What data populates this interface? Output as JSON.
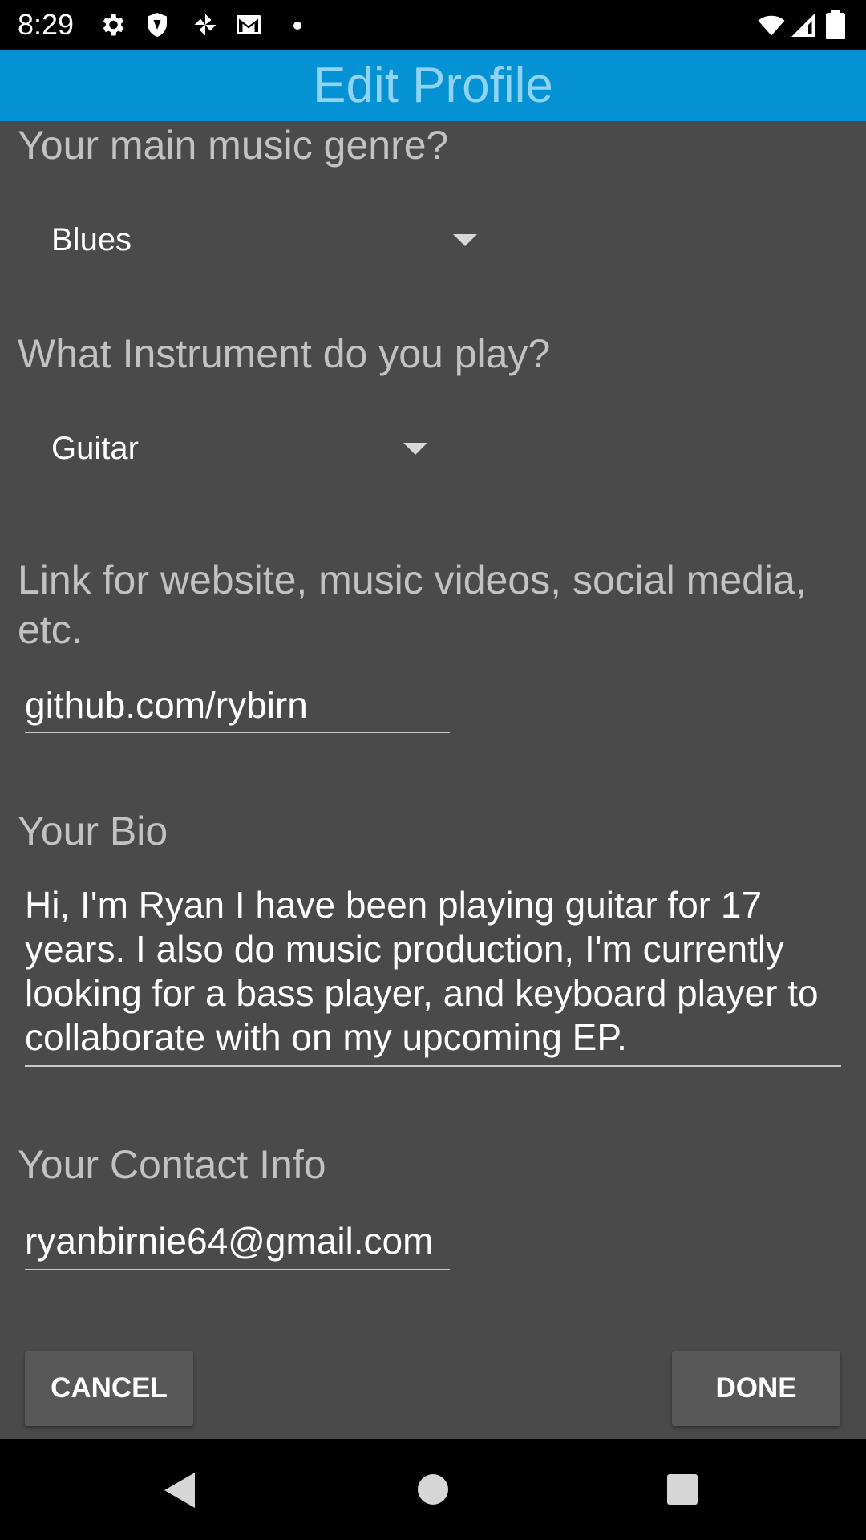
{
  "status_bar": {
    "time": "8:29",
    "icons": [
      "gear-icon",
      "shield-icon",
      "pinwheel-icon",
      "gmail-icon",
      "notification-dot",
      "wifi-icon",
      "signal-icon",
      "battery-icon"
    ]
  },
  "app_bar": {
    "title": "Edit Profile",
    "color": "#0592d4"
  },
  "form": {
    "genre": {
      "label": "Your main music genre?",
      "selected": "Blues"
    },
    "instrument": {
      "label": "What Instrument do you play?",
      "selected": "Guitar"
    },
    "link": {
      "label": "Link for website, music videos, social media, etc.",
      "value": "github.com/rybirn"
    },
    "bio": {
      "label": "Your Bio",
      "value": "Hi, I'm Ryan I have been playing guitar for 17 years. I also do music production, I'm currently looking for a bass player, and keyboard player to collaborate with on my upcoming EP."
    },
    "contact": {
      "label": "Your Contact Info",
      "value": "ryanbirnie64@gmail.com"
    }
  },
  "buttons": {
    "cancel": "CANCEL",
    "done": "DONE"
  },
  "nav_bar": {
    "icons": [
      "back-icon",
      "home-icon",
      "recents-icon"
    ]
  }
}
